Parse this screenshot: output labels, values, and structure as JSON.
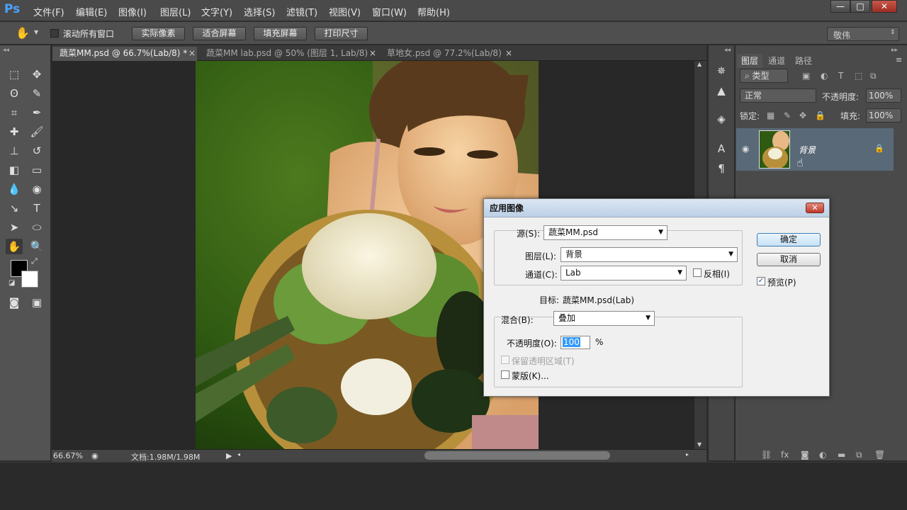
{
  "app": {
    "logo": "Ps"
  },
  "menubar": {
    "items": [
      "文件(F)",
      "编辑(E)",
      "图像(I)",
      "图层(L)",
      "文字(Y)",
      "选择(S)",
      "滤镜(T)",
      "视图(V)",
      "窗口(W)",
      "帮助(H)"
    ],
    "window_buttons": {
      "minimize": "—",
      "maximize": "□",
      "close": "✕"
    }
  },
  "options_bar": {
    "scroll_all_label": "滚动所有窗口",
    "buttons": [
      "实际像素",
      "适合屏幕",
      "填充屏幕",
      "打印尺寸"
    ],
    "workspace": "敬伟"
  },
  "document_tabs": [
    {
      "label": "蔬菜MM.psd @ 66.7%(Lab/8) *",
      "active": true
    },
    {
      "label": "蔬菜MM lab.psd @ 50% (图层 1, Lab/8)",
      "active": false
    },
    {
      "label": "草地女.psd @ 77.2%(Lab/8)",
      "active": false
    }
  ],
  "status_bar": {
    "zoom": "66.67%",
    "doc_info": "文档:1.98M/1.98M"
  },
  "layers_panel": {
    "tabs": [
      "图层",
      "通道",
      "路径"
    ],
    "filter_kind": "类型",
    "blend_mode": "正常",
    "opacity_label": "不透明度:",
    "opacity_value": "100%",
    "lock_label": "锁定:",
    "fill_label": "填充:",
    "fill_value": "100%",
    "layers": [
      {
        "name": "背景",
        "locked": true,
        "visible": true
      }
    ]
  },
  "dialog": {
    "title": "应用图像",
    "source_label": "源(S):",
    "source_value": "蔬菜MM.psd",
    "layer_label": "图层(L):",
    "layer_value": "背景",
    "channel_label": "通道(C):",
    "channel_value": "Lab",
    "invert_label": "反相(I)",
    "target_label": "目标:",
    "target_value": "蔬菜MM.psd(Lab)",
    "blending_label": "混合(B):",
    "blending_value": "叠加",
    "opacity_label": "不透明度(O):",
    "opacity_value": "100",
    "opacity_unit": "%",
    "preserve_label": "保留透明区域(T)",
    "mask_label": "蒙版(K)...",
    "ok_label": "确定",
    "cancel_label": "取消",
    "preview_label": "预览(P)",
    "preview_checked": true
  }
}
